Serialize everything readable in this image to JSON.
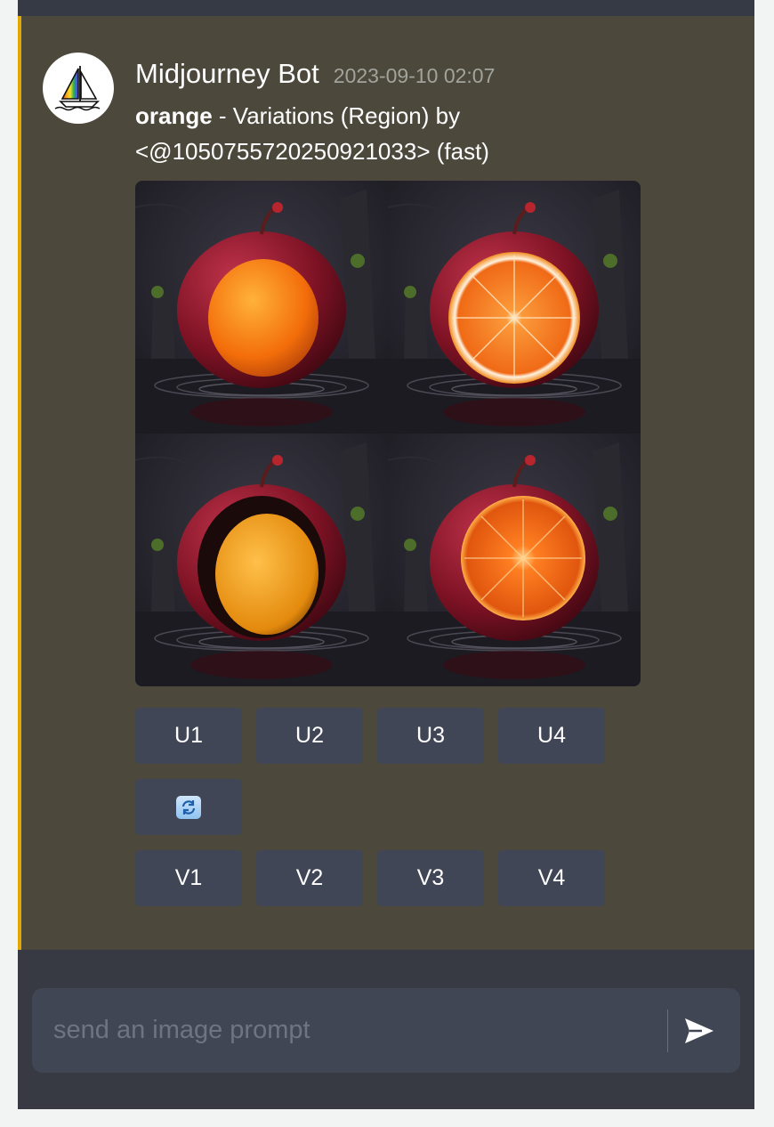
{
  "message": {
    "author": "Midjourney Bot",
    "timestamp": "2023-09-10 02:07",
    "prompt_bold": "orange",
    "prompt_rest": " - Variations (Region) by <@1050755720250921033> (fast)",
    "accent_color": "#e0a800"
  },
  "avatar": {
    "icon": "sailboat-logo-icon"
  },
  "image_grid": {
    "tiles": [
      {
        "description_icon": "apple-with-whole-orange"
      },
      {
        "description_icon": "apple-with-orange-slice"
      },
      {
        "description_icon": "apple-with-dripping-orange"
      },
      {
        "description_icon": "apple-with-juicy-orange-slice"
      }
    ]
  },
  "buttons": {
    "upscale": [
      "U1",
      "U2",
      "U3",
      "U4"
    ],
    "reroll_icon": "refresh-icon",
    "variation": [
      "V1",
      "V2",
      "V3",
      "V4"
    ]
  },
  "composer": {
    "placeholder": "send an image prompt",
    "send_icon": "send-arrow-icon"
  }
}
